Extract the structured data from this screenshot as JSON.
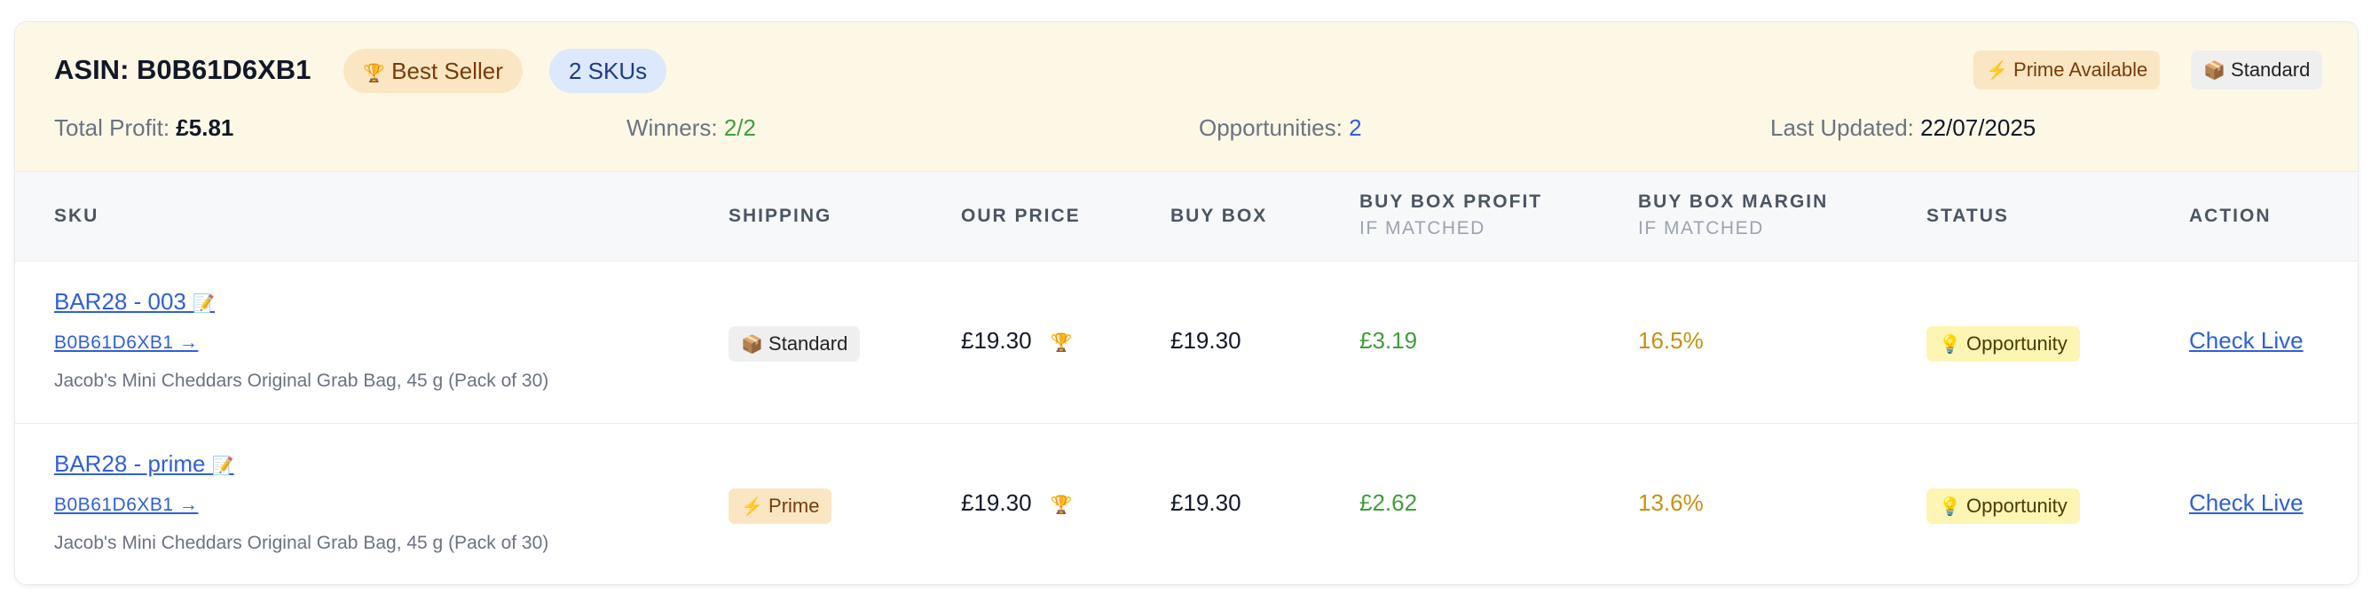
{
  "header": {
    "asin_title": "ASIN: B0B61D6XB1",
    "best_seller_icon": "trophy-icon",
    "best_seller_label": "Best Seller",
    "skus_label": "2 SKUs",
    "prime_icon": "lightning-icon",
    "prime_label": "Prime Available",
    "standard_icon": "package-icon",
    "standard_label": "Standard",
    "stats": {
      "total_profit_label": "Total Profit:",
      "total_profit_value": "£5.81",
      "winners_label": "Winners:",
      "winners_value": "2/2",
      "opportunities_label": "Opportunities:",
      "opportunities_value": "2",
      "last_updated_label": "Last Updated:",
      "last_updated_value": "22/07/2025"
    }
  },
  "table": {
    "columns": {
      "sku": "SKU",
      "shipping": "SHIPPING",
      "our_price": "OUR PRICE",
      "buy_box": "BUY BOX",
      "buy_box_profit": "BUY BOX PROFIT",
      "buy_box_profit_sub": "IF MATCHED",
      "buy_box_margin": "BUY BOX MARGIN",
      "buy_box_margin_sub": "IF MATCHED",
      "status": "STATUS",
      "action": "ACTION"
    },
    "rows": [
      {
        "sku": "BAR28 - 003",
        "sku_icon": "memo-icon",
        "asin": "B0B61D6XB1 →",
        "description": "Jacob's Mini Cheddars Original Grab Bag, 45 g (Pack of 30)",
        "shipping_icon": "package-icon",
        "shipping": "Standard",
        "our_price": "£19.30",
        "price_icon": "trophy-icon",
        "buy_box": "£19.30",
        "profit": "£3.19",
        "margin": "16.5%",
        "status_icon": "lightbulb-icon",
        "status": "Opportunity",
        "action": "Check Live"
      },
      {
        "sku": "BAR28 - prime",
        "sku_icon": "memo-icon",
        "asin": "B0B61D6XB1 →",
        "description": "Jacob's Mini Cheddars Original Grab Bag, 45 g (Pack of 30)",
        "shipping_icon": "lightning-icon",
        "shipping": "Prime",
        "our_price": "£19.30",
        "price_icon": "trophy-icon",
        "buy_box": "£19.30",
        "profit": "£2.62",
        "margin": "13.6%",
        "status_icon": "lightbulb-icon",
        "status": "Opportunity",
        "action": "Check Live"
      }
    ]
  },
  "colors": {
    "header_bg": "#fdf8e6",
    "link": "#2f5fd8",
    "profit": "#3f9d3c",
    "margin": "#c8900f",
    "status_bg": "#fdf5b3"
  }
}
